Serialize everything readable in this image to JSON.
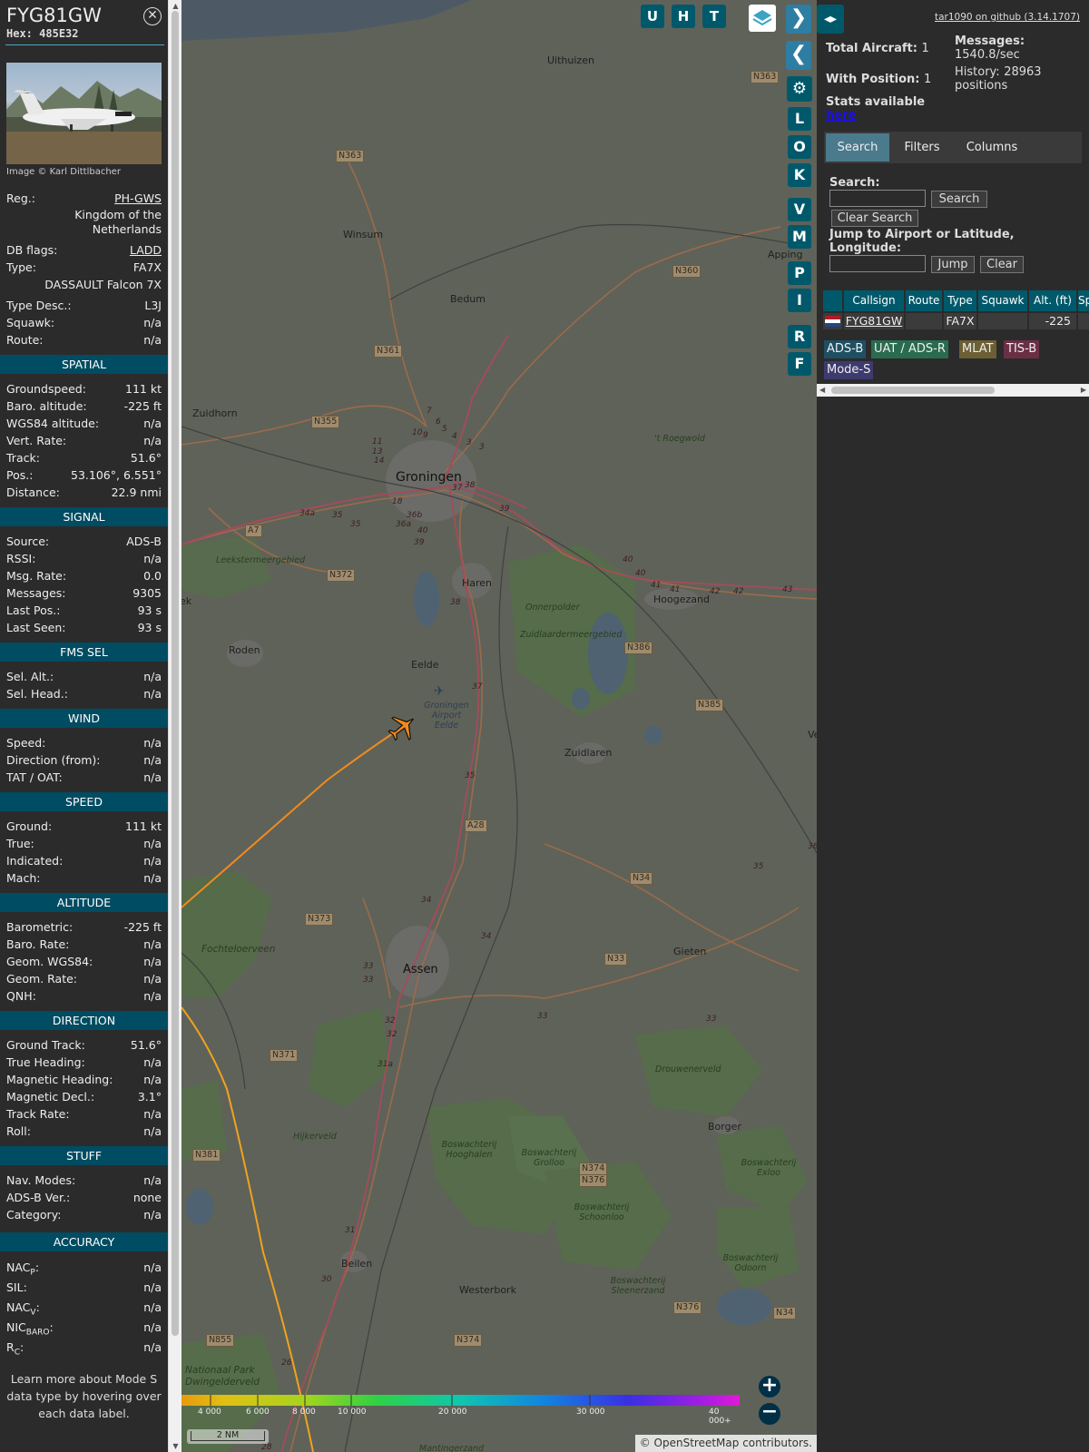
{
  "info": {
    "callsign": "FYG81GW",
    "hex_label": "Hex:",
    "hex": "485E32",
    "photo_credit": "Image © Karl Dittlbacher",
    "reg_label": "Reg.:",
    "reg": "PH-GWS",
    "country": "Kingdom of the Netherlands",
    "dbflags_label": "DB flags:",
    "dbflags": "LADD",
    "type_label": "Type:",
    "type": "FA7X",
    "type_full": "DASSAULT Falcon 7X",
    "typedesc_label": "Type Desc.:",
    "typedesc": "L3J",
    "squawk_label": "Squawk:",
    "squawk": "n/a",
    "route_label": "Route:",
    "route": "n/a"
  },
  "spatial": {
    "title": "SPATIAL",
    "rows": [
      {
        "k": "Groundspeed:",
        "v": "111 kt"
      },
      {
        "k": "Baro. altitude:",
        "v": "-225 ft"
      },
      {
        "k": "WGS84 altitude:",
        "v": "n/a"
      },
      {
        "k": "Vert. Rate:",
        "v": "n/a"
      },
      {
        "k": "Track:",
        "v": "51.6°"
      },
      {
        "k": "Pos.:",
        "v": "53.106°, 6.551°"
      },
      {
        "k": "Distance:",
        "v": "22.9 nmi"
      }
    ]
  },
  "signal": {
    "title": "SIGNAL",
    "rows": [
      {
        "k": "Source:",
        "v": "ADS-B"
      },
      {
        "k": "RSSI:",
        "v": "n/a"
      },
      {
        "k": "Msg. Rate:",
        "v": "0.0"
      },
      {
        "k": "Messages:",
        "v": "9305"
      },
      {
        "k": "Last Pos.:",
        "v": "93 s"
      },
      {
        "k": "Last Seen:",
        "v": "93 s"
      }
    ]
  },
  "fms": {
    "title": "FMS SEL",
    "rows": [
      {
        "k": "Sel. Alt.:",
        "v": "n/a"
      },
      {
        "k": "Sel. Head.:",
        "v": "n/a"
      }
    ]
  },
  "wind": {
    "title": "WIND",
    "rows": [
      {
        "k": "Speed:",
        "v": "n/a"
      },
      {
        "k": "Direction (from):",
        "v": "n/a"
      },
      {
        "k": "TAT / OAT:",
        "v": "n/a"
      }
    ]
  },
  "speed": {
    "title": "SPEED",
    "rows": [
      {
        "k": "Ground:",
        "v": "111 kt"
      },
      {
        "k": "True:",
        "v": "n/a"
      },
      {
        "k": "Indicated:",
        "v": "n/a"
      },
      {
        "k": "Mach:",
        "v": "n/a"
      }
    ]
  },
  "altitude": {
    "title": "ALTITUDE",
    "rows": [
      {
        "k": "Barometric:",
        "v": "-225 ft"
      },
      {
        "k": "Baro. Rate:",
        "v": "n/a"
      },
      {
        "k": "Geom. WGS84:",
        "v": "n/a"
      },
      {
        "k": "Geom. Rate:",
        "v": "n/a"
      },
      {
        "k": "QNH:",
        "v": "n/a"
      }
    ]
  },
  "direction": {
    "title": "DIRECTION",
    "rows": [
      {
        "k": "Ground Track:",
        "v": "51.6°"
      },
      {
        "k": "True Heading:",
        "v": "n/a"
      },
      {
        "k": "Magnetic Heading:",
        "v": "n/a"
      },
      {
        "k": "Magnetic Decl.:",
        "v": "3.1°"
      },
      {
        "k": "Track Rate:",
        "v": "n/a"
      },
      {
        "k": "Roll:",
        "v": "n/a"
      }
    ]
  },
  "stuff": {
    "title": "STUFF",
    "rows": [
      {
        "k": "Nav. Modes:",
        "v": "n/a"
      },
      {
        "k": "ADS-B Ver.:",
        "v": "none"
      },
      {
        "k": "Category:",
        "v": "n/a"
      }
    ]
  },
  "accuracy": {
    "title": "ACCURACY",
    "nacp_base": "NAC",
    "nacp_sub": "P",
    "nacp_v": "n/a",
    "sil_label": "SIL:",
    "sil_v": "n/a",
    "nacv_base": "NAC",
    "nacv_sub": "V",
    "nacv_v": "n/a",
    "nic_base": "NIC",
    "nic_sub": "BARO",
    "nic_v": "n/a",
    "rc_base": "R",
    "rc_sub": "C",
    "rc_v": "n/a",
    "colon": ":"
  },
  "learn_more": "Learn more about Mode S data type by hovering over each data label.",
  "map": {
    "top_buttons": [
      "U",
      "H",
      "T"
    ],
    "side_buttons": [
      "L",
      "O",
      "K",
      "V",
      "M",
      "P",
      "I",
      "R",
      "F"
    ],
    "places": {
      "uithuizen": "Uithuizen",
      "winsum": "Winsum",
      "bedum": "Bedum",
      "zuidhorn": "Zuidhorn",
      "groningen": "Groningen",
      "haren": "Haren",
      "hoogezand": "Hoogezand",
      "roden": "Roden",
      "eelde": "Eelde",
      "airport": "Groningen Airport Eelde",
      "zuidlaren": "Zuidlaren",
      "assen": "Assen",
      "gieten": "Gieten",
      "borger": "Borger",
      "beilen": "Beilen",
      "westerbork": "Westerbork",
      "appingedam": "Apping",
      "veendam": "Ve",
      "roegwold": "'t Roegwold",
      "leekster": "Leekstermeergebied",
      "onnerpolder": "Onnerpolder",
      "zuidlaardermeer": "Zuidlaardermeergebied",
      "fochteloo": "Fochteloerveen",
      "drouwen": "Drouwenerveld",
      "hijkerveld": "Hijkerveld",
      "hooghalen": "Boswachterij Hooghalen",
      "grolloo": "Boswachterij Grolloo",
      "schoonloo": "Boswachterij Schoonloo",
      "exloo": "Boswachterij Exloo",
      "odoorn": "Boswachterij Odoorn",
      "sleenerzand": "Boswachterij Sleenerzand",
      "dwingelderveld": "Nationaal Park Dwingelderveld",
      "mantinge": "Mantingerzand",
      "leek": "ek"
    },
    "roads": [
      "N363",
      "N363",
      "N360",
      "N361",
      "N355",
      "N372",
      "N386",
      "N385",
      "N34",
      "N373",
      "N33",
      "N371",
      "N374",
      "N376",
      "N381",
      "N376",
      "N34",
      "N855",
      "N374",
      "N33",
      "A7",
      "A28"
    ],
    "junctions": [
      "10",
      "9",
      "7",
      "6",
      "5",
      "4",
      "3",
      "3",
      "11",
      "13",
      "14",
      "37",
      "38",
      "39",
      "36b",
      "36a",
      "40",
      "39",
      "34a",
      "35",
      "35",
      "18",
      "40",
      "40",
      "41",
      "41",
      "42",
      "42",
      "43",
      "38",
      "37",
      "35",
      "34",
      "34",
      "33",
      "33",
      "33",
      "33",
      "32",
      "32",
      "31a",
      "31",
      "30",
      "26",
      "28",
      "36",
      "35"
    ],
    "altitude_ticks": [
      "4 000",
      "6 000",
      "8 000",
      "10 000",
      "20 000",
      "30 000",
      "40 000+"
    ],
    "scale": "2 NM",
    "attribution_prefix": "© ",
    "attribution_link": "OpenStreetMap",
    "attribution_suffix": " contributors."
  },
  "right": {
    "github_link": "tar1090 on github (3.14.1707)",
    "total_label": "Total Aircraft:",
    "total": "1",
    "position_label": "With Position:",
    "position": "1",
    "messages_label": "Messages:",
    "messages": "1540.8/sec",
    "history_label": "History:",
    "history": "28963 positions",
    "stats_label": "Stats available",
    "stats_link": "here",
    "tabs": [
      "Search",
      "Filters",
      "Columns"
    ],
    "search_label": "Search:",
    "search_value": "",
    "search_button": "Search",
    "clear_search_button": "Clear Search",
    "jump_label": "Jump to Airport or Latitude, Longitude:",
    "jump_value": "",
    "jump_button": "Jump",
    "clear_button": "Clear",
    "table_headers": [
      "Callsign",
      "Route",
      "Type",
      "Squawk",
      "Alt. (ft)",
      "Sp"
    ],
    "table_row": {
      "callsign": "FYG81GW",
      "route": "",
      "type": "FA7X",
      "squawk": "",
      "alt": "-225"
    },
    "sources": [
      "ADS-B",
      "UAT / ADS-R",
      "MLAT",
      "TIS-B",
      "Mode-S"
    ]
  },
  "colors": {
    "sidebar_bg": "#2b2b2b",
    "section": "#004c62",
    "button": "#00596b",
    "track": "#f08a1e",
    "adsb": "#1f4f63",
    "uat": "#2a6b4f",
    "mlat": "#6b5f33",
    "tisb": "#6b2f45",
    "modes": "#3d3a6e"
  }
}
